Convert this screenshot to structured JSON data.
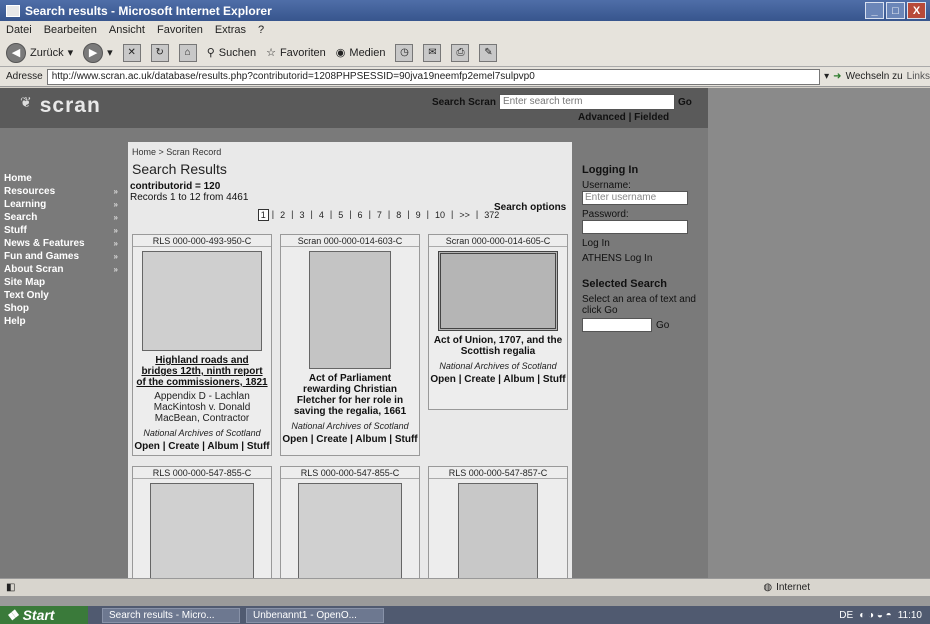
{
  "window": {
    "title": "Search results - Microsoft Internet Explorer",
    "controls": [
      "_",
      "□",
      "X"
    ]
  },
  "menu": [
    "Datei",
    "Bearbeiten",
    "Ansicht",
    "Favoriten",
    "Extras",
    "?"
  ],
  "toolbar": {
    "back": "Zurück",
    "search": "Suchen",
    "favorites": "Favoriten",
    "media": "Medien"
  },
  "address": {
    "label": "Adresse",
    "url": "http://www.scran.ac.uk/database/results.php?contributorid=1208PHPSESSID=90jva19neemfp2emel7sulpvp0",
    "go": "Wechseln zu",
    "links": "Links"
  },
  "site": {
    "logo": "scran",
    "search_label": "Search Scran",
    "search_placeholder": "Enter search term",
    "search_go": "Go",
    "advanced": "Advanced | Fielded"
  },
  "sidebar": [
    {
      "label": "Home",
      "arrow": ""
    },
    {
      "label": "Resources",
      "arrow": "»"
    },
    {
      "label": "Learning",
      "arrow": "»"
    },
    {
      "label": "Search",
      "arrow": "»"
    },
    {
      "label": "Stuff",
      "arrow": "»"
    },
    {
      "label": "News & Features",
      "arrow": "»"
    },
    {
      "label": "Fun and Games",
      "arrow": "»"
    },
    {
      "label": "About Scran",
      "arrow": "»"
    },
    {
      "label": "Site Map",
      "arrow": ""
    },
    {
      "label": "Text Only",
      "arrow": ""
    },
    {
      "label": "Shop",
      "arrow": ""
    },
    {
      "label": "Help",
      "arrow": ""
    }
  ],
  "main": {
    "breadcrumb": "Home > Scran Record",
    "title": "Search Results",
    "query": "contributorid = 120",
    "records": "Records 1 to 12 from 4461",
    "search_options": "Search options",
    "pages": [
      "1",
      "2",
      "3",
      "4",
      "5",
      "6",
      "7",
      "8",
      "9",
      "10",
      ">>",
      "372"
    ]
  },
  "results": [
    {
      "id": "RLS 000-000-493-950-C",
      "title": "Highland roads and bridges 12th, ninth report of the commissioners, 1821",
      "sub": "Appendix D - Lachlan MacKintosh v. Donald MacBean, Contractor",
      "source": "National Archives of Scotland",
      "actions": "Open | Create | Album | Stuff"
    },
    {
      "id": "Scran 000-000-014-603-C",
      "title": "Act of Parliament rewarding Christian Fletcher for her role in saving the regalia, 1661",
      "sub": "",
      "source": "National Archives of Scotland",
      "actions": "Open | Create | Album | Stuff"
    },
    {
      "id": "Scran 000-000-014-605-C",
      "title": "Act of Union, 1707, and the Scottish regalia",
      "sub": "",
      "source": "National Archives of Scotland",
      "actions": "Open | Create | Album | Stuff"
    },
    {
      "id": "RLS 000-000-547-855-C",
      "title": "",
      "sub": "",
      "source": "",
      "actions": ""
    },
    {
      "id": "RLS 000-000-547-855-C",
      "title": "",
      "sub": "",
      "source": "",
      "actions": ""
    },
    {
      "id": "RLS 000-000-547-857-C",
      "title": "",
      "sub": "",
      "source": "",
      "actions": ""
    }
  ],
  "login": {
    "heading": "Logging In",
    "username_label": "Username:",
    "username_placeholder": "Enter username",
    "password_label": "Password:",
    "login": "Log In",
    "athens": "ATHENS Log In"
  },
  "selected_search": {
    "heading": "Selected Search",
    "hint": "Select an area of text and click Go",
    "go": "Go"
  },
  "status": {
    "zone": "Internet"
  },
  "taskbar": {
    "start": "Start",
    "tasks": [
      "Search results - Micro...",
      "Unbenannt1 - OpenO..."
    ],
    "lang": "DE",
    "time": "11:10"
  }
}
